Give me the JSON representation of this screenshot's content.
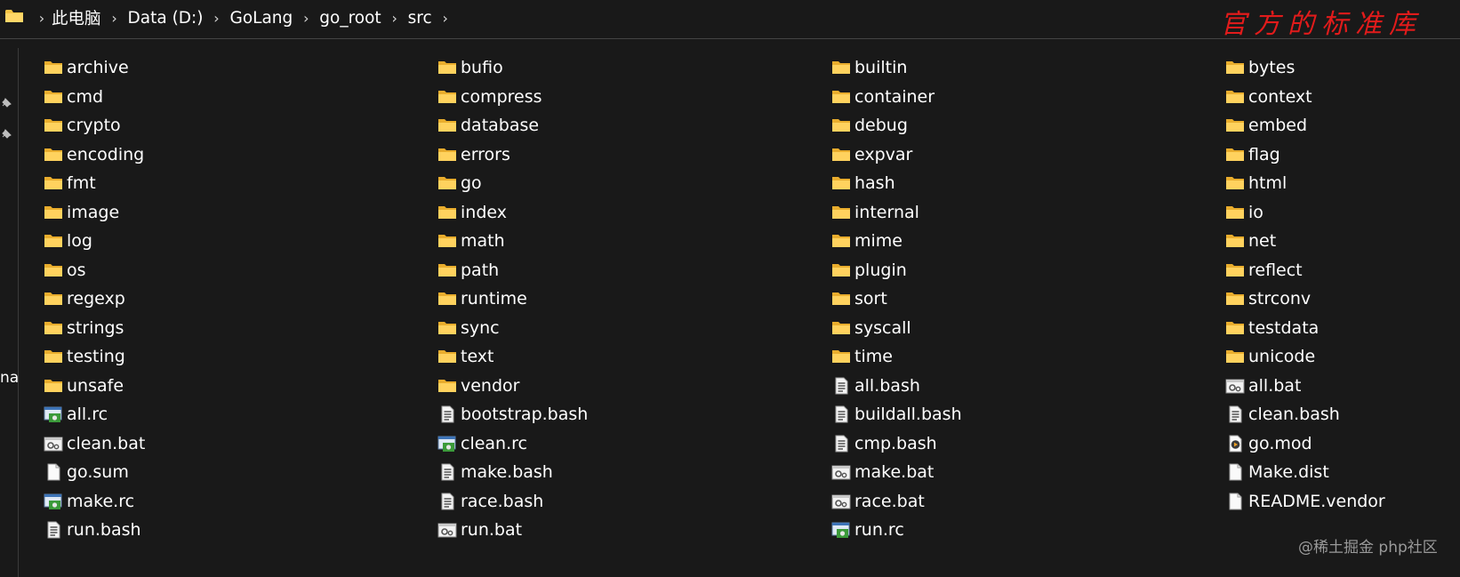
{
  "address_bar": {
    "breadcrumbs": [
      "此电脑",
      "Data (D:)",
      "GoLang",
      "go_root",
      "src"
    ],
    "separator": "›",
    "annotation": "官方的标准库"
  },
  "nav_pane": {
    "partial_label": "na"
  },
  "files": [
    {
      "name": "archive",
      "type": "folder"
    },
    {
      "name": "bufio",
      "type": "folder"
    },
    {
      "name": "builtin",
      "type": "folder"
    },
    {
      "name": "bytes",
      "type": "folder"
    },
    {
      "name": "cmd",
      "type": "folder"
    },
    {
      "name": "compress",
      "type": "folder"
    },
    {
      "name": "container",
      "type": "folder"
    },
    {
      "name": "context",
      "type": "folder"
    },
    {
      "name": "crypto",
      "type": "folder"
    },
    {
      "name": "database",
      "type": "folder"
    },
    {
      "name": "debug",
      "type": "folder"
    },
    {
      "name": "embed",
      "type": "folder"
    },
    {
      "name": "encoding",
      "type": "folder"
    },
    {
      "name": "errors",
      "type": "folder"
    },
    {
      "name": "expvar",
      "type": "folder"
    },
    {
      "name": "flag",
      "type": "folder"
    },
    {
      "name": "fmt",
      "type": "folder"
    },
    {
      "name": "go",
      "type": "folder"
    },
    {
      "name": "hash",
      "type": "folder"
    },
    {
      "name": "html",
      "type": "folder"
    },
    {
      "name": "image",
      "type": "folder"
    },
    {
      "name": "index",
      "type": "folder"
    },
    {
      "name": "internal",
      "type": "folder"
    },
    {
      "name": "io",
      "type": "folder"
    },
    {
      "name": "log",
      "type": "folder"
    },
    {
      "name": "math",
      "type": "folder"
    },
    {
      "name": "mime",
      "type": "folder"
    },
    {
      "name": "net",
      "type": "folder"
    },
    {
      "name": "os",
      "type": "folder"
    },
    {
      "name": "path",
      "type": "folder"
    },
    {
      "name": "plugin",
      "type": "folder"
    },
    {
      "name": "reflect",
      "type": "folder"
    },
    {
      "name": "regexp",
      "type": "folder"
    },
    {
      "name": "runtime",
      "type": "folder"
    },
    {
      "name": "sort",
      "type": "folder"
    },
    {
      "name": "strconv",
      "type": "folder"
    },
    {
      "name": "strings",
      "type": "folder"
    },
    {
      "name": "sync",
      "type": "folder"
    },
    {
      "name": "syscall",
      "type": "folder"
    },
    {
      "name": "testdata",
      "type": "folder"
    },
    {
      "name": "testing",
      "type": "folder"
    },
    {
      "name": "text",
      "type": "folder"
    },
    {
      "name": "time",
      "type": "folder"
    },
    {
      "name": "unicode",
      "type": "folder"
    },
    {
      "name": "unsafe",
      "type": "folder"
    },
    {
      "name": "vendor",
      "type": "folder"
    },
    {
      "name": "all.bash",
      "type": "text-file"
    },
    {
      "name": "all.bat",
      "type": "batch-file"
    },
    {
      "name": "all.rc",
      "type": "rc-file"
    },
    {
      "name": "bootstrap.bash",
      "type": "text-file"
    },
    {
      "name": "buildall.bash",
      "type": "text-file"
    },
    {
      "name": "clean.bash",
      "type": "text-file"
    },
    {
      "name": "clean.bat",
      "type": "batch-file"
    },
    {
      "name": "clean.rc",
      "type": "rc-file"
    },
    {
      "name": "cmp.bash",
      "type": "text-file"
    },
    {
      "name": "go.mod",
      "type": "media-file"
    },
    {
      "name": "go.sum",
      "type": "blank-file"
    },
    {
      "name": "make.bash",
      "type": "text-file"
    },
    {
      "name": "make.bat",
      "type": "batch-file"
    },
    {
      "name": "Make.dist",
      "type": "blank-file"
    },
    {
      "name": "make.rc",
      "type": "rc-file"
    },
    {
      "name": "race.bash",
      "type": "text-file"
    },
    {
      "name": "race.bat",
      "type": "batch-file"
    },
    {
      "name": "README.vendor",
      "type": "blank-file"
    },
    {
      "name": "run.bash",
      "type": "text-file"
    },
    {
      "name": "run.bat",
      "type": "batch-file"
    },
    {
      "name": "run.rc",
      "type": "rc-file"
    }
  ],
  "corner_watermark": "@稀土掘金 php社区",
  "colors": {
    "background": "#191919",
    "text": "#ffffff",
    "folder": "#f6c344",
    "annotation": "#e11b1b"
  }
}
